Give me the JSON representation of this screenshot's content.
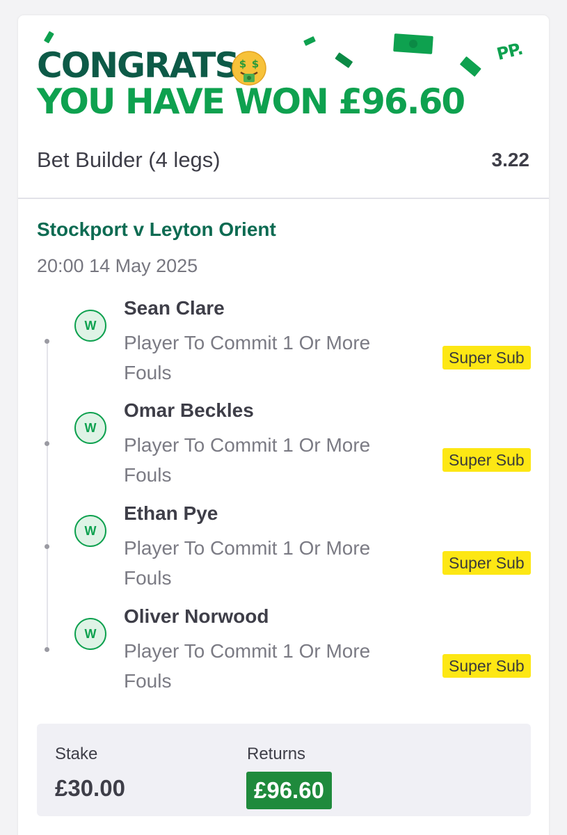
{
  "banner": {
    "congrats": "CONGRATS!",
    "won_prefix": "YOU HAVE WON",
    "won_amount": "£96.60",
    "emoji_icon": "money-mouth-face-icon",
    "logo": "PP."
  },
  "bet": {
    "title": "Bet Builder (4 legs)",
    "odds": "3.22"
  },
  "event": {
    "match": "Stockport v Leyton Orient",
    "datetime": "20:00 14 May 2025"
  },
  "legs": [
    {
      "result": "W",
      "player": "Sean Clare",
      "market": "Player To Commit 1 Or More Fouls",
      "tag": "Super Sub"
    },
    {
      "result": "W",
      "player": "Omar Beckles",
      "market": "Player To Commit 1 Or More Fouls",
      "tag": "Super Sub"
    },
    {
      "result": "W",
      "player": "Ethan Pye",
      "market": "Player To Commit 1 Or More Fouls",
      "tag": "Super Sub"
    },
    {
      "result": "W",
      "player": "Oliver Norwood",
      "market": "Player To Commit 1 Or More Fouls",
      "tag": "Super Sub"
    }
  ],
  "summary": {
    "stake_label": "Stake",
    "stake_value": "£30.00",
    "returns_label": "Returns",
    "returns_value": "£96.60"
  },
  "colors": {
    "brand_dark_green": "#0d5a47",
    "brand_green": "#0ea14f",
    "returns_green": "#1f8a3c",
    "super_sub_yellow": "#fde714"
  }
}
